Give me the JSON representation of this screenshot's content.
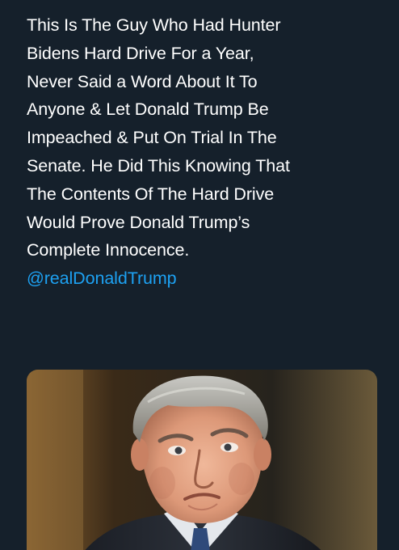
{
  "tweet": {
    "lines": [
      "This Is The Guy Who Had Hunter",
      "Bidens Hard Drive For a Year,",
      "Never Said a Word About It To",
      "Anyone & Let Donald Trump Be",
      "Impeached & Put On Trial In The",
      "Senate. He Did This Knowing That",
      "The Contents Of The Hard Drive",
      "Would Prove Donald Trump’s",
      "Complete Innocence."
    ],
    "mention": "@realDonaldTrump"
  },
  "colors": {
    "background": "#15202b",
    "text": "#ffffff",
    "link": "#1da1f2"
  }
}
